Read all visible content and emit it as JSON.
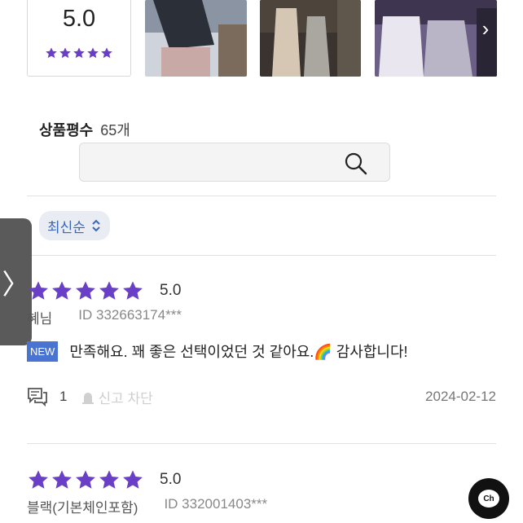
{
  "summary": {
    "average_score": "5.0",
    "star_rating": 5,
    "star_color": "#6a3fc8"
  },
  "photos": [
    {
      "icon": "review-photo-thumbnail"
    },
    {
      "icon": "review-photo-thumbnail"
    },
    {
      "icon": "review-photo-thumbnail"
    }
  ],
  "photo_next_icon": "›",
  "review_count": {
    "label": "상품평수",
    "value": "65개"
  },
  "search": {
    "placeholder": "",
    "value": ""
  },
  "sort": {
    "selected": "최신순",
    "accent": "#3a66b8"
  },
  "side_tab": {
    "glyph": "〉"
  },
  "reviews": [
    {
      "rating": 5,
      "score": "5.0",
      "author": "혜님",
      "user_id": "ID 332663174***",
      "badge": "NEW",
      "text": "만족해요. 꽤 좋은 선택이었던 것 같아요.🌈 감사합니다!",
      "comment_count": "1",
      "report_label": "신고 차단",
      "date": "2024-02-12"
    },
    {
      "rating": 5,
      "score": "5.0",
      "author": "블랙(기본체인포함)",
      "user_id": "ID 332001403***"
    }
  ],
  "chat": {
    "label": "Ch"
  }
}
